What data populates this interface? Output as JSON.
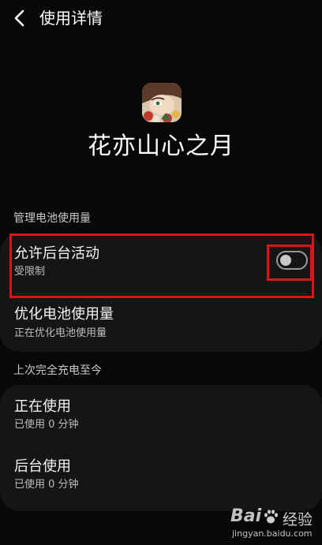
{
  "header": {
    "title": "使用详情"
  },
  "app": {
    "name": "花亦山心之月"
  },
  "battery_section": {
    "label": "管理电池使用量",
    "background_activity": {
      "title": "允许后台活动",
      "subtitle": "受限制",
      "enabled": false
    },
    "optimize": {
      "title": "优化电池使用量",
      "subtitle": "正在优化电池使用量"
    }
  },
  "since_charge_section": {
    "label": "上次完全充电至今",
    "foreground": {
      "title": "正在使用",
      "subtitle": "已使用 0 分钟"
    },
    "background": {
      "title": "后台使用",
      "subtitle": "已使用 0 分钟"
    }
  },
  "watermark": {
    "logo": "Bai",
    "cn": "经验",
    "url": "jingyan.baidu.com"
  },
  "colors": {
    "highlight": "#d81616",
    "background": "#080808",
    "card": "#151515"
  }
}
